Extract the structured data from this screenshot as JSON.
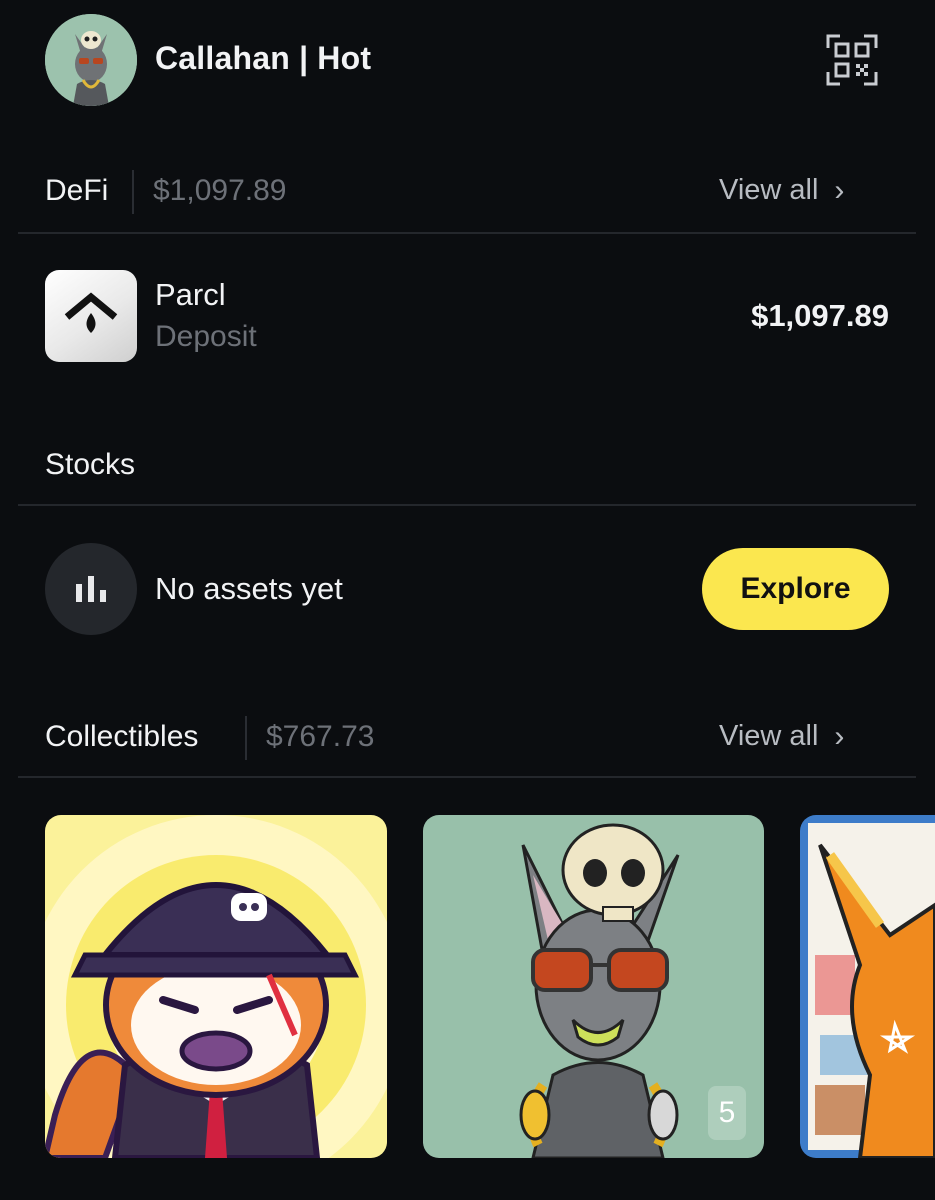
{
  "header": {
    "account_name": "Callahan | Hot",
    "avatar_icon": "skull-cat-avatar",
    "qr_icon": "qr-code-icon"
  },
  "defi": {
    "title": "DeFi",
    "total": "$1,097.89",
    "view_all": "View all",
    "items": [
      {
        "name": "Parcl",
        "subtitle": "Deposit",
        "value": "$1,097.89",
        "icon": "parcl-logo"
      }
    ]
  },
  "stocks": {
    "title": "Stocks",
    "empty_text": "No assets yet",
    "explore_label": "Explore",
    "icon": "bar-chart-icon"
  },
  "collectibles": {
    "title": "Collectibles",
    "total": "$767.73",
    "view_all": "View all",
    "cards": [
      {
        "name": "fox-in-cap",
        "count": null
      },
      {
        "name": "skull-cat",
        "count": "5"
      },
      {
        "name": "orange-fox-painting",
        "count": null
      }
    ]
  },
  "colors": {
    "background": "#0b0d10",
    "accent_yellow": "#fbe74f",
    "muted_text": "#6d7178"
  }
}
